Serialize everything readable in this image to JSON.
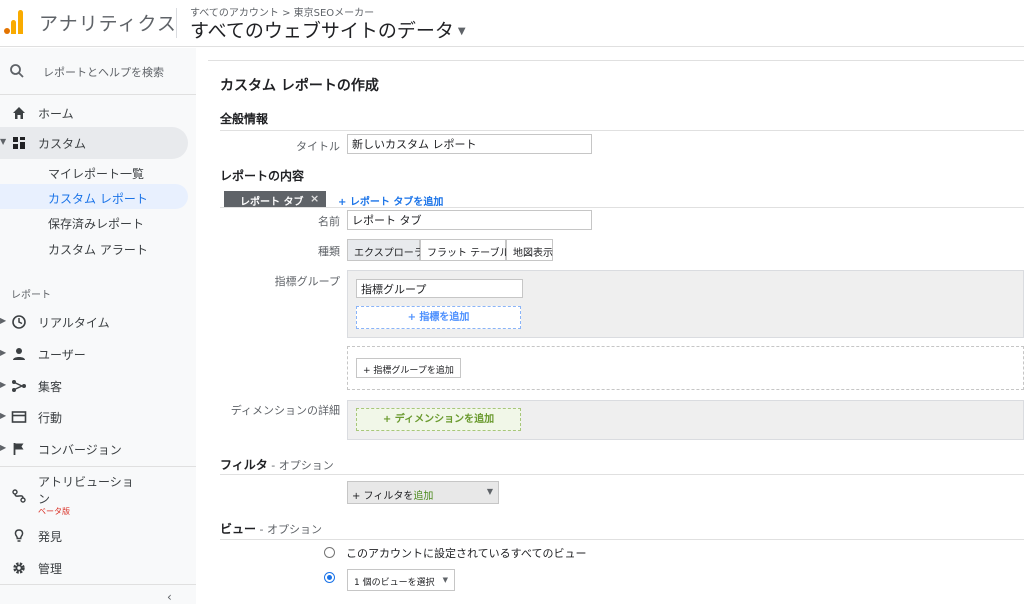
{
  "header": {
    "app_title": "アナリティクス",
    "breadcrumb": "すべてのアカウント > 東京SEOメーカー",
    "view_name": "すべてのウェブサイトのデータ"
  },
  "sidebar": {
    "search_label": "レポートとヘルプを検索",
    "home": "ホーム",
    "custom": "カスタム",
    "custom_items": [
      "マイレポート一覧",
      "カスタム レポート",
      "保存済みレポート",
      "カスタム アラート"
    ],
    "reports_section": "レポート",
    "reports": [
      "リアルタイム",
      "ユーザー",
      "集客",
      "行動",
      "コンバージョン"
    ],
    "attribution_line1": "アトリビューショ",
    "attribution_line2": "ン",
    "beta": "ベータ版",
    "discover": "発見",
    "admin": "管理",
    "collapse": "‹"
  },
  "main": {
    "page_title": "カスタム レポートの作成",
    "general": {
      "heading": "全般情報",
      "title_label": "タイトル",
      "title_value": "新しいカスタム レポート"
    },
    "content": {
      "heading": "レポートの内容",
      "tab_label": "レポート タブ",
      "tab_close": "×",
      "add_tab": "+ レポート タブを追加",
      "name_label": "名前",
      "name_value": "レポート タブ",
      "type_label": "種類",
      "types": [
        "エクスプローラ",
        "フラット テーブル",
        "地図表示"
      ],
      "metric_group_label": "指標グループ",
      "metric_group_value": "指標グループ",
      "add_metric": "+ 指標を追加",
      "add_metric_group": "+ 指標グループを追加",
      "dimension_label": "ディメンションの詳細",
      "add_dimension": "+ ディメンションを追加"
    },
    "filter": {
      "heading": "フィルタ",
      "optional": " - オプション",
      "btn_prefix": "+ フィルタを",
      "btn_suffix": "追加"
    },
    "views": {
      "heading": "ビュー",
      "optional": " - オプション",
      "option_all": "このアカウントに設定されているすべてのビュー",
      "select_label": "1 個のビューを選択"
    }
  }
}
